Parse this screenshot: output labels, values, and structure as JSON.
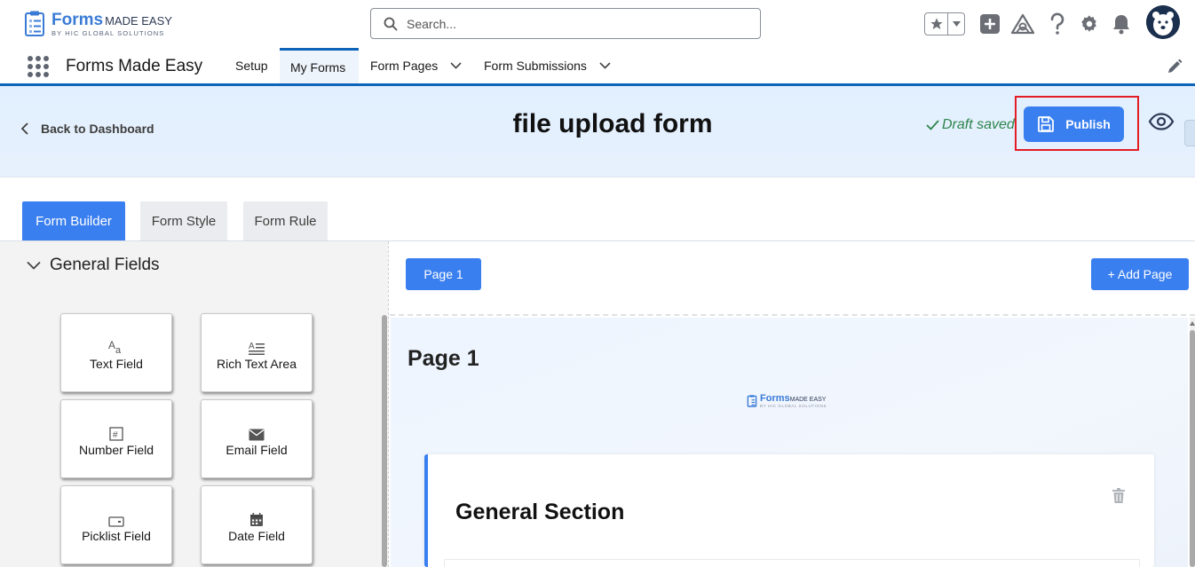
{
  "brand": {
    "logo_main": "Forms",
    "logo_made_easy": "MADE EASY",
    "logo_sub": "BY HIC GLOBAL SOLUTIONS",
    "accent": "#3a7ff0",
    "nav_accent": "#0e64b8"
  },
  "header": {
    "search_placeholder": "Search..."
  },
  "nav": {
    "app_name": "Forms Made Easy",
    "items": [
      {
        "label": "Setup",
        "active": false,
        "has_menu": false
      },
      {
        "label": "My Forms",
        "active": true,
        "has_menu": false
      },
      {
        "label": "Form Pages",
        "active": false,
        "has_menu": true
      },
      {
        "label": "Form Submissions",
        "active": false,
        "has_menu": true
      }
    ]
  },
  "builder": {
    "back_label": "Back to Dashboard",
    "form_title": "file upload form",
    "draft_status": "Draft saved",
    "publish_label": "Publish"
  },
  "tabs": [
    {
      "label": "Form Builder",
      "active": true
    },
    {
      "label": "Form Style",
      "active": false
    },
    {
      "label": "Form Rule",
      "active": false
    }
  ],
  "palette": {
    "group_title": "General Fields",
    "fields": [
      {
        "label": "Text Field",
        "icon": "text-field-icon"
      },
      {
        "label": "Rich Text Area",
        "icon": "rich-text-icon"
      },
      {
        "label": "Number Field",
        "icon": "number-icon"
      },
      {
        "label": "Email Field",
        "icon": "email-icon"
      },
      {
        "label": "Picklist Field",
        "icon": "picklist-icon"
      },
      {
        "label": "Date Field",
        "icon": "calendar-icon"
      }
    ]
  },
  "pages": {
    "page_button": "Page 1",
    "add_page_button": "+ Add Page",
    "page_heading": "Page 1"
  },
  "section": {
    "title": "General Section"
  }
}
